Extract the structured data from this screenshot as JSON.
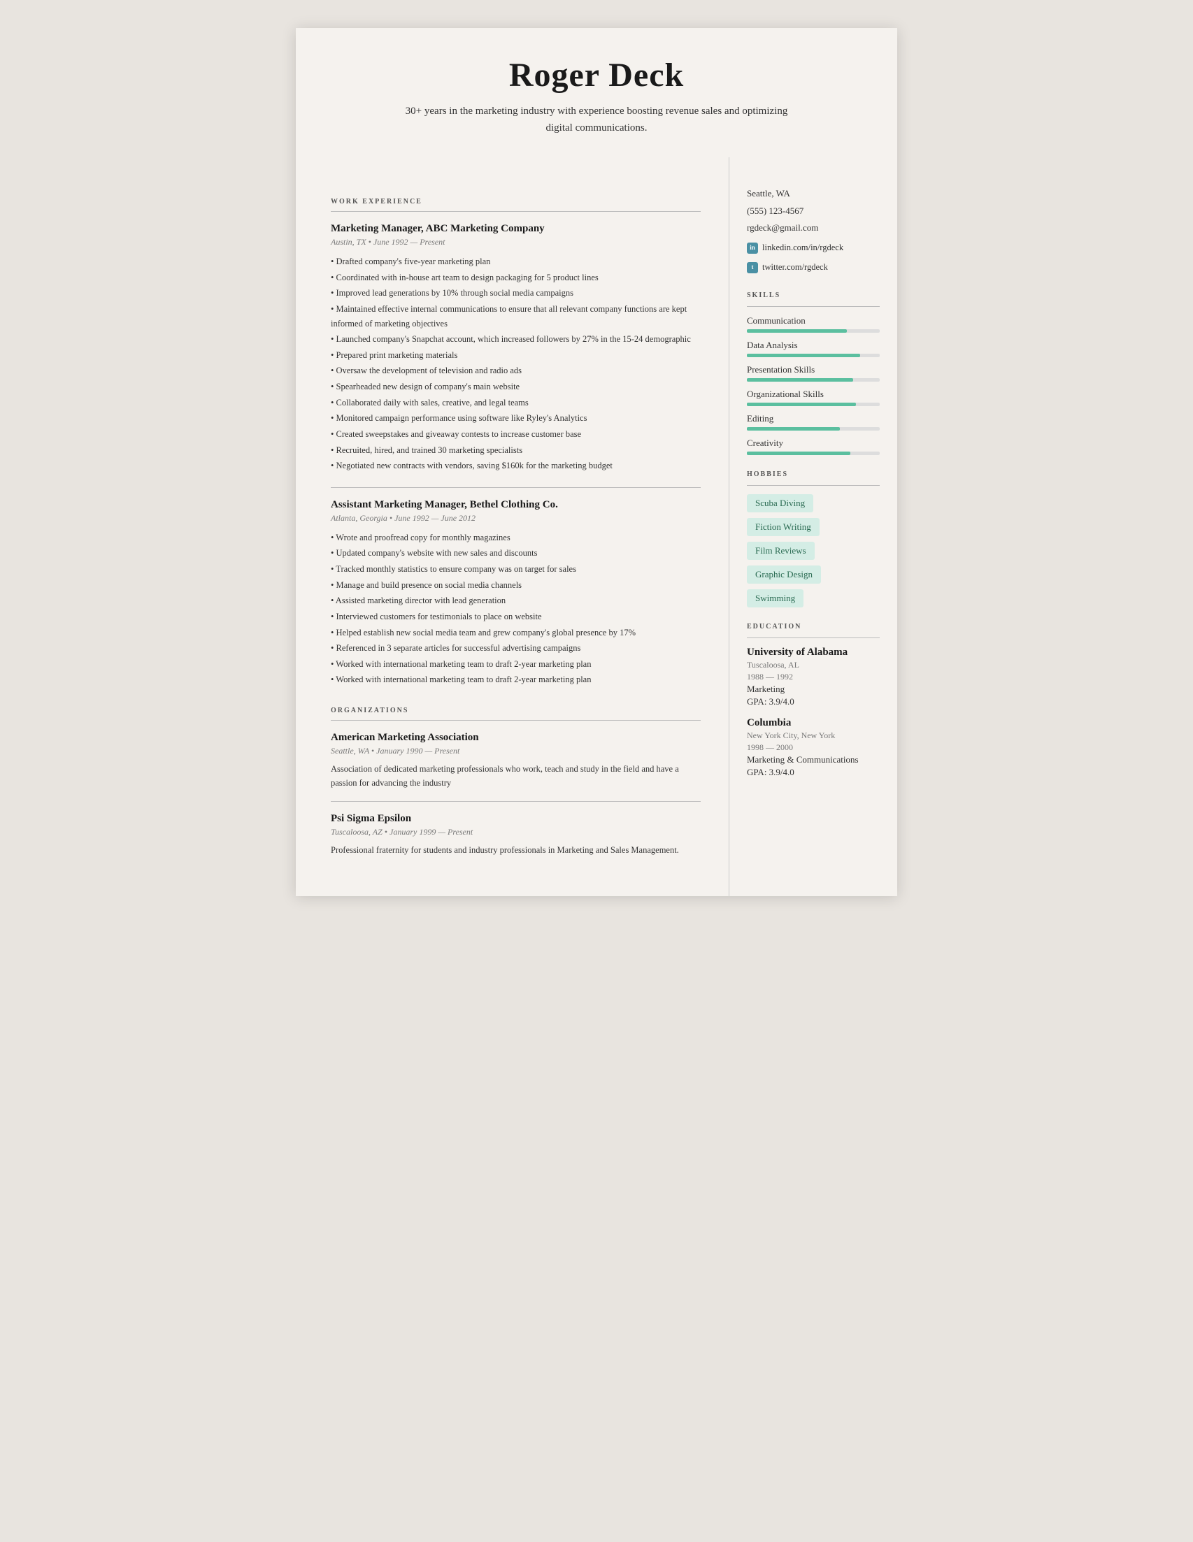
{
  "header": {
    "name": "Roger Deck",
    "tagline": "30+ years in the marketing industry with experience boosting revenue sales and optimizing digital communications."
  },
  "contact": {
    "location": "Seattle, WA",
    "phone": "(555) 123-4567",
    "email": "rgdeck@gmail.com",
    "linkedin": "linkedin.com/in/rgdeck",
    "twitter": "twitter.com/rgdeck"
  },
  "sections": {
    "work_experience_label": "WORK EXPERIENCE",
    "organizations_label": "ORGANIZATIONS",
    "skills_label": "SKILLS",
    "hobbies_label": "HOBBIES",
    "education_label": "EDUCATION"
  },
  "work_experience": [
    {
      "title": "Marketing Manager, ABC Marketing Company",
      "meta": "Austin, TX • June 1992 — Present",
      "bullets": [
        "• Drafted company's five-year marketing plan",
        "• Coordinated with in-house art team to design packaging for 5 product lines",
        "• Improved lead generations by 10% through social media campaigns",
        "• Maintained effective internal communications to ensure that all relevant company functions are kept informed of marketing objectives",
        "• Launched company's Snapchat account, which increased followers by 27% in the 15-24 demographic",
        "• Prepared print marketing materials",
        "• Oversaw the development of television and radio ads",
        "• Spearheaded new design of company's main website",
        "• Collaborated daily with sales, creative, and legal teams",
        "• Monitored campaign performance using software like Ryley's Analytics",
        "• Created sweepstakes and giveaway contests to increase customer base",
        "• Recruited, hired, and trained 30 marketing specialists",
        "• Negotiated new contracts with vendors, saving $160k for the marketing budget"
      ]
    },
    {
      "title": "Assistant Marketing Manager, Bethel Clothing Co.",
      "meta": "Atlanta, Georgia • June 1992 — June 2012",
      "bullets": [
        "• Wrote and proofread copy for monthly magazines",
        "• Updated company's website with new sales and discounts",
        "• Tracked monthly statistics to ensure company was on target for sales",
        "• Manage and build presence on social media channels",
        "• Assisted marketing director with lead generation",
        "• Interviewed customers for testimonials to place on website",
        "• Helped establish new social media team and grew company's global presence by 17%",
        "• Referenced in 3 separate articles for successful advertising campaigns",
        "• Worked with international marketing team to draft 2-year marketing plan",
        "• Worked with international marketing team to draft 2-year marketing plan"
      ]
    }
  ],
  "organizations": [
    {
      "title": "American Marketing Association",
      "meta": "Seattle, WA • January 1990 — Present",
      "description": "Association of dedicated marketing professionals who work, teach and study in the field and have a passion for advancing the industry"
    },
    {
      "title": "Psi Sigma Epsilon",
      "meta": "Tuscaloosa, AZ • January 1999 — Present",
      "description": "Professional fraternity for students and industry professionals in Marketing and Sales Management."
    }
  ],
  "skills": [
    {
      "name": "Communication",
      "level": 75
    },
    {
      "name": "Data Analysis",
      "level": 85
    },
    {
      "name": "Presentation Skills",
      "level": 80
    },
    {
      "name": "Organizational Skills",
      "level": 82
    },
    {
      "name": "Editing",
      "level": 70
    },
    {
      "name": "Creativity",
      "level": 78
    }
  ],
  "hobbies": [
    "Scuba Diving",
    "Fiction Writing",
    "Film Reviews",
    "Graphic Design",
    "Swimming"
  ],
  "education": [
    {
      "school": "University of Alabama",
      "location": "Tuscaloosa, AL",
      "years": "1988 — 1992",
      "field": "Marketing",
      "gpa": "GPA: 3.9/4.0"
    },
    {
      "school": "Columbia",
      "location": "New York City, New York",
      "years": "1998 — 2000",
      "field": "Marketing & Communications",
      "gpa": "GPA: 3.9/4.0"
    }
  ]
}
